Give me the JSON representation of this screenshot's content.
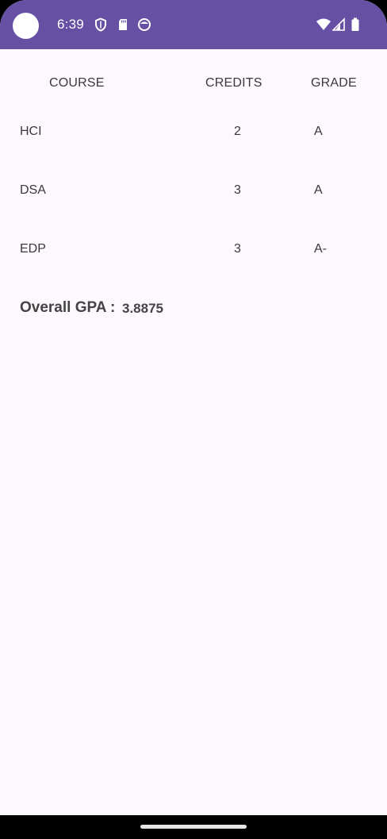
{
  "status_bar": {
    "time": "6:39",
    "color": "#6650a4",
    "left_icons": [
      "shield-icon",
      "sd-card-icon",
      "face-icon"
    ],
    "right_icons": [
      "wifi-icon",
      "cell-signal-icon",
      "battery-icon"
    ]
  },
  "table": {
    "headers": {
      "course": "COURSE",
      "credits": "CREDITS",
      "grade": "GRADE"
    },
    "rows": [
      {
        "course": "HCI",
        "credits": "2",
        "grade": "A"
      },
      {
        "course": "DSA",
        "credits": "3",
        "grade": "A"
      },
      {
        "course": "EDP",
        "credits": "3",
        "grade": "A-"
      }
    ]
  },
  "gpa": {
    "label": "Overall GPA :",
    "value": "3.8875"
  },
  "background_color": "#fdf7fe"
}
